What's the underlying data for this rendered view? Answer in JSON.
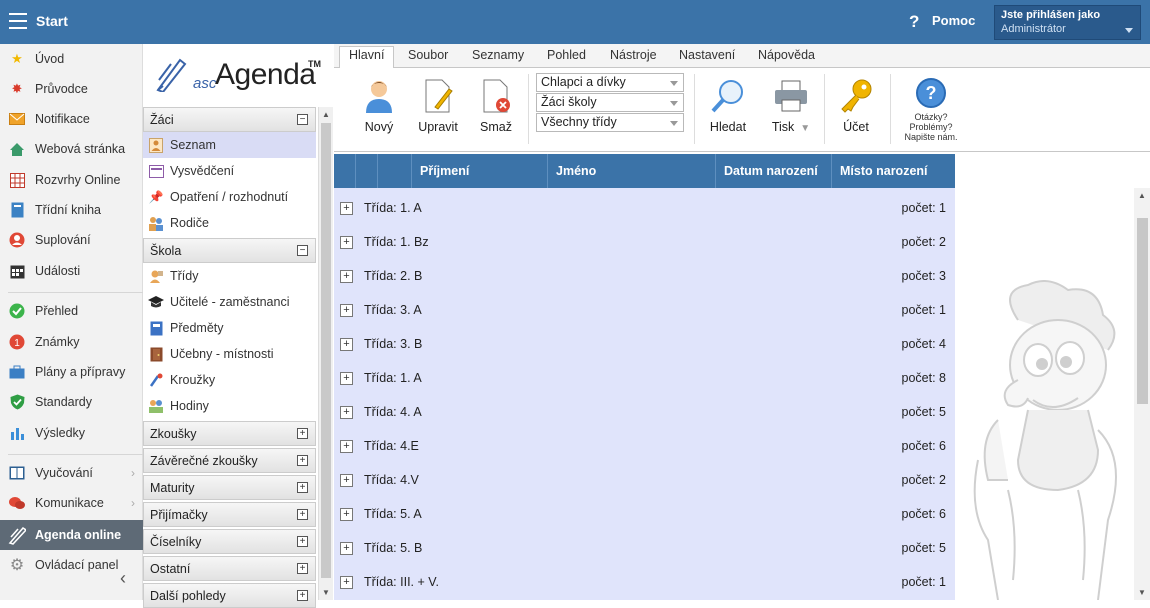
{
  "topbar": {
    "start_label": "Start",
    "help_label": "Pomoc",
    "help_icon": "?",
    "user_line1": "Jste přihlášen jako",
    "user_line2": "Administrátor"
  },
  "leftnav": {
    "items": [
      {
        "label": "Úvod",
        "icon": "star-icon"
      },
      {
        "label": "Průvodce",
        "icon": "wand-icon"
      },
      {
        "label": "Notifikace",
        "icon": "envelope-icon"
      },
      {
        "label": "Webová stránka",
        "icon": "house-icon"
      },
      {
        "label": "Rozvrhy Online",
        "icon": "timetable-icon"
      },
      {
        "label": "Třídní kniha",
        "icon": "book-icon"
      },
      {
        "label": "Suplování",
        "icon": "person-icon"
      },
      {
        "label": "Události",
        "icon": "calendar-icon"
      },
      {
        "label": "Přehled",
        "icon": "check-icon"
      },
      {
        "label": "Známky",
        "icon": "grades-icon"
      },
      {
        "label": "Plány a přípravy",
        "icon": "briefcase-icon"
      },
      {
        "label": "Standardy",
        "icon": "shield-icon"
      },
      {
        "label": "Výsledky",
        "icon": "bar-chart-icon"
      },
      {
        "label": "Vyučování",
        "icon": "open-book-icon"
      },
      {
        "label": "Komunikace",
        "icon": "chat-icon"
      },
      {
        "label": "Agenda online",
        "icon": "agenda-pen-icon"
      },
      {
        "label": "Ovládací panel",
        "icon": "gear-icon"
      }
    ],
    "collapse": "‹"
  },
  "agenda": {
    "logo_asc": "asc",
    "logo_agenda": "Agenda",
    "logo_tm": "TM",
    "sections": {
      "zaci": {
        "title": "Žáci",
        "toggle": "−"
      },
      "skola": {
        "title": "Škola",
        "toggle": "−"
      },
      "zkousky": {
        "title": "Zkoušky",
        "toggle": "+"
      },
      "zaverecne": {
        "title": "Závěrečné zkoušky",
        "toggle": "+"
      },
      "maturity": {
        "title": "Maturity",
        "toggle": "+"
      },
      "prijimacky": {
        "title": "Přijímačky",
        "toggle": "+"
      },
      "ciselniky": {
        "title": "Číselníky",
        "toggle": "+"
      },
      "ostatni": {
        "title": "Ostatní",
        "toggle": "+"
      },
      "dalsi": {
        "title": "Další pohledy",
        "toggle": "+"
      }
    },
    "zaci_items": [
      "Seznam",
      "Vysvědčení",
      "Opatření / rozhodnutí",
      "Rodiče"
    ],
    "skola_items": [
      "Třídy",
      "Učitelé - zaměstnanci",
      "Předměty",
      "Učebny - místnosti",
      "Kroužky",
      "Hodiny"
    ]
  },
  "ribbon": {
    "tabs": [
      "Hlavní",
      "Soubor",
      "Seznamy",
      "Pohled",
      "Nástroje",
      "Nastavení",
      "Nápověda"
    ],
    "buttons": {
      "new": "Nový",
      "edit": "Upravit",
      "delete": "Smaž",
      "search": "Hledat",
      "print": "Tisk",
      "account": "Účet"
    },
    "selects": {
      "gender": "Chlapci a dívky",
      "students": "Žáci školy",
      "classes": "Všechny třídy"
    },
    "help_q": "?",
    "help_text": [
      "Otázky?",
      "Problémy?",
      "Napište nám."
    ]
  },
  "table": {
    "headers": {
      "surname": "Příjmení",
      "name": "Jméno",
      "dob": "Datum narození",
      "pob": "Místo narození"
    },
    "rows": [
      {
        "cls": "Třída: 1. A",
        "count": "počet: 1"
      },
      {
        "cls": "Třída: 1. Bz",
        "count": "počet: 2"
      },
      {
        "cls": "Třída: 2. B",
        "count": "počet: 3"
      },
      {
        "cls": "Třída: 3. A",
        "count": "počet: 1"
      },
      {
        "cls": "Třída: 3. B",
        "count": "počet: 4"
      },
      {
        "cls": "Třída: 1. A",
        "count": "počet: 8"
      },
      {
        "cls": "Třída: 4. A",
        "count": "počet: 5"
      },
      {
        "cls": "Třída: 4.E",
        "count": "počet: 6"
      },
      {
        "cls": "Třída: 4.V",
        "count": "počet: 2"
      },
      {
        "cls": "Třída: 5. A",
        "count": "počet: 6"
      },
      {
        "cls": "Třída: 5. B",
        "count": "počet: 5"
      },
      {
        "cls": "Třída: III. + V.",
        "count": "počet: 1"
      }
    ],
    "expand_symbol": "+"
  },
  "colors": {
    "primary": "#3b73a8",
    "table_body": "#e0e4fb",
    "selected": "#d9dcf5"
  }
}
